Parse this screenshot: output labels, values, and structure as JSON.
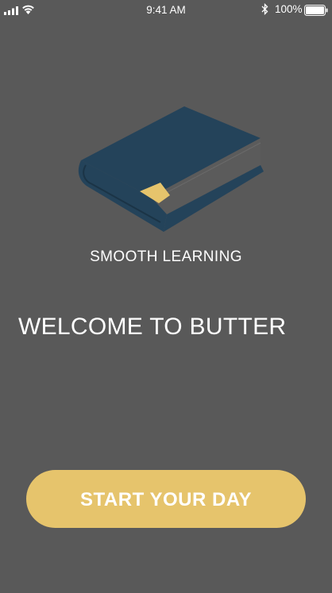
{
  "status_bar": {
    "time": "9:41 AM",
    "battery_percent": "100%",
    "battery_level": 1.0,
    "icons": [
      "signal-icon",
      "wifi-icon",
      "bluetooth-icon",
      "battery-icon"
    ]
  },
  "hero": {
    "image": "book-icon",
    "tagline": "SMOOTH LEARNING"
  },
  "main": {
    "welcome_text": "WELCOME TO BUTTER"
  },
  "actions": {
    "start_label": "START YOUR DAY"
  },
  "colors": {
    "background": "#595959",
    "accent": "#e6c46c",
    "book_cover": "#24435a",
    "book_pages": "#5b5b5b",
    "bookmark": "#e6c46c",
    "text": "#ffffff"
  }
}
